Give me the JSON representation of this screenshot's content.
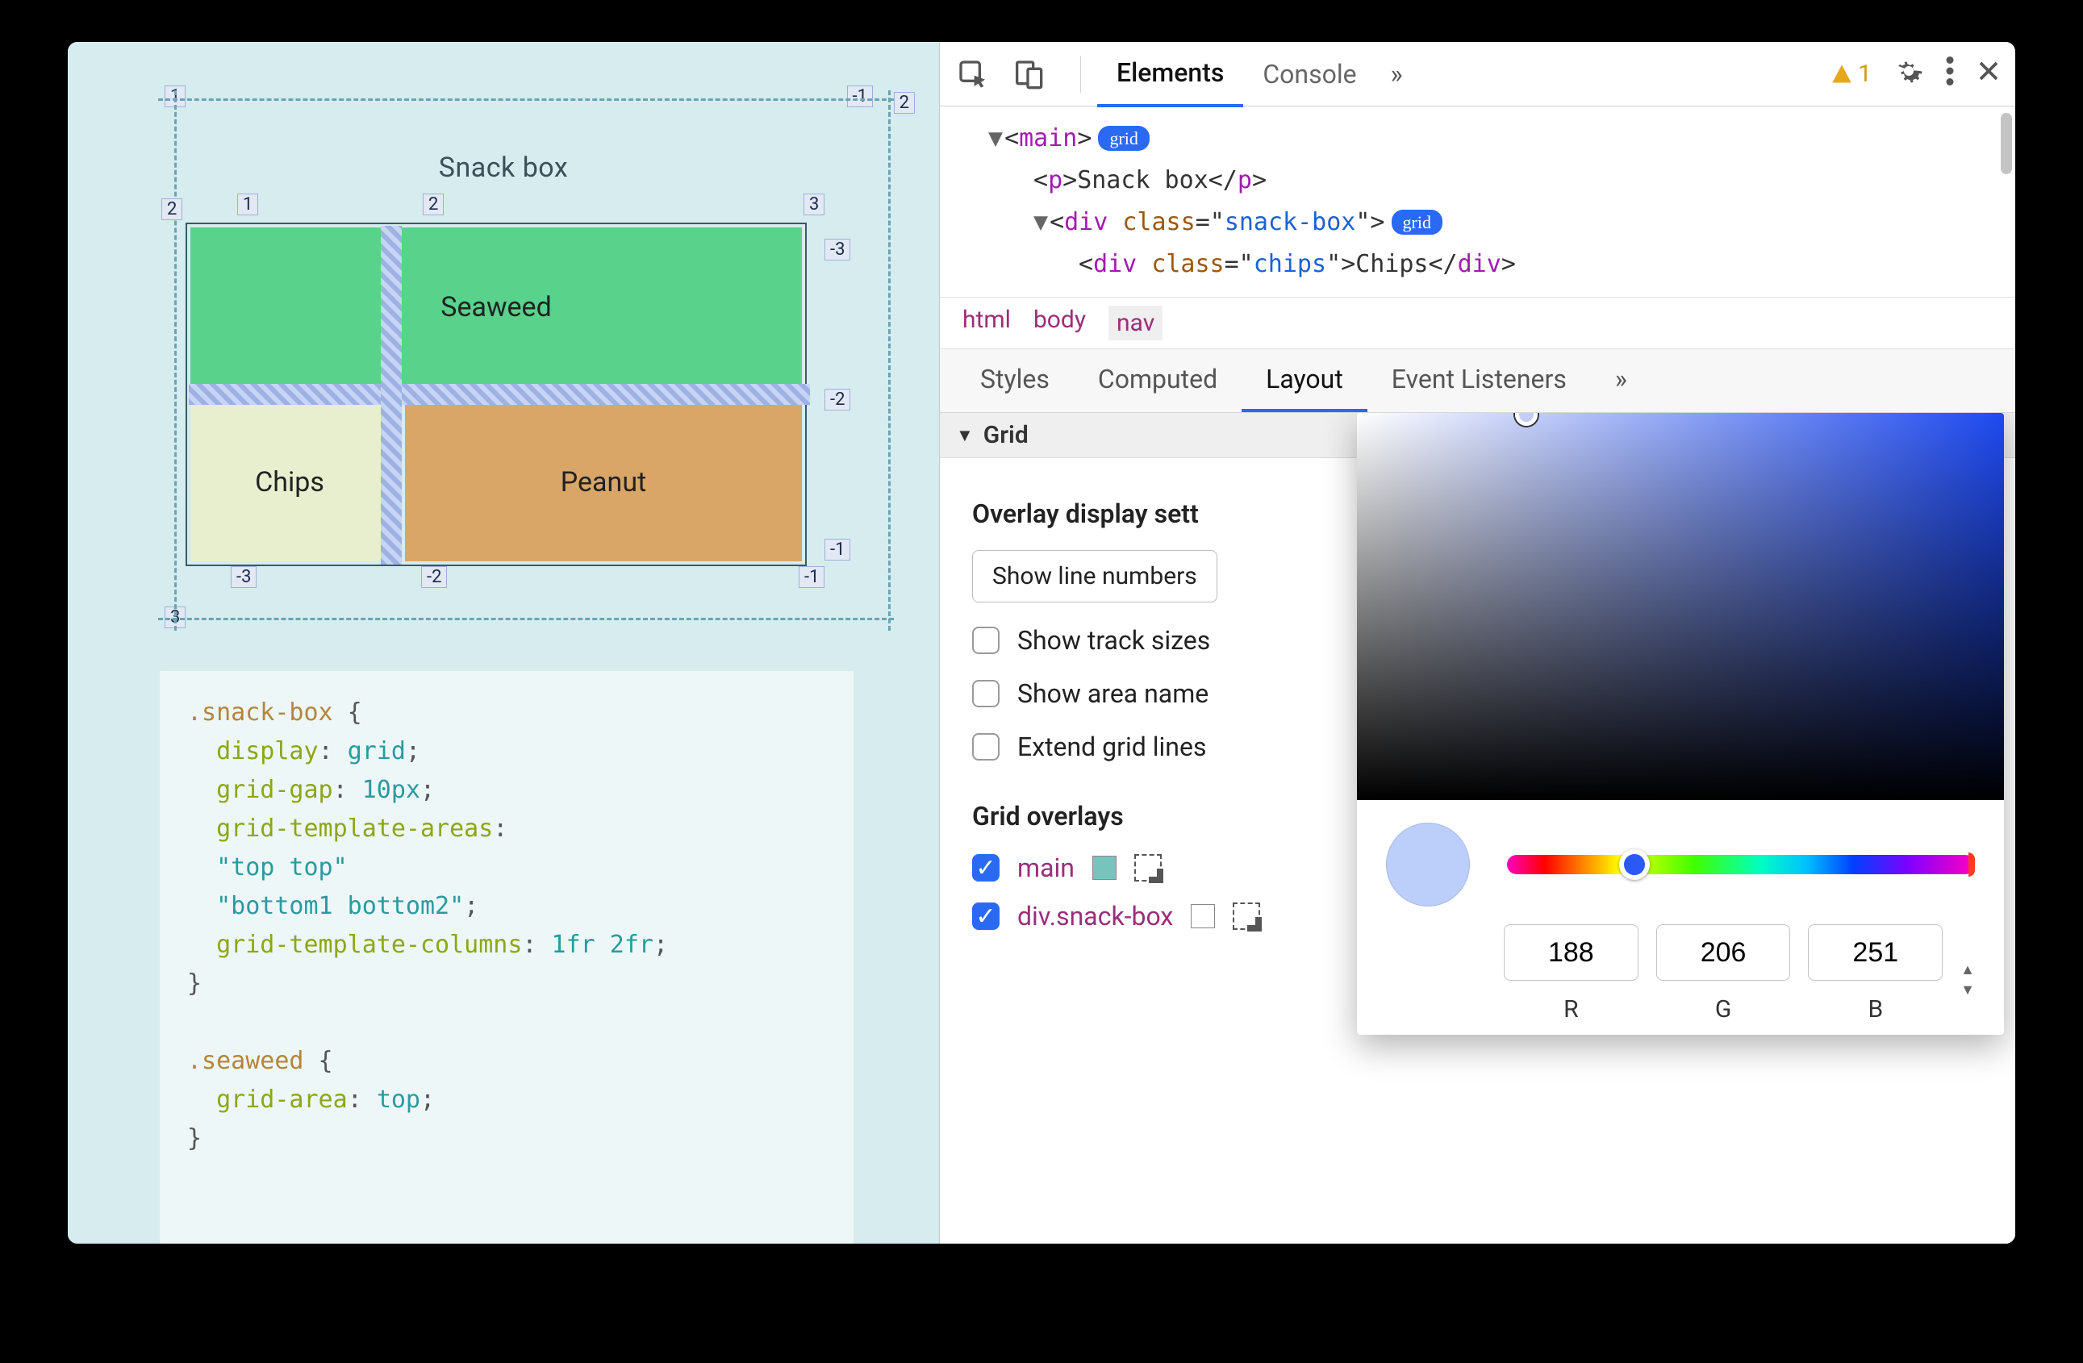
{
  "preview": {
    "title": "Snack box",
    "cells": {
      "seaweed": "Seaweed",
      "chips": "Chips",
      "peanut": "Peanut"
    },
    "code": ".snack-box {\n  display: grid;\n  grid-gap: 10px;\n  grid-template-areas:\n  \"top top\"\n  \"bottom1 bottom2\";\n  grid-template-columns: 1fr 2fr;\n}\n\n.seaweed {\n  grid-area: top;\n}"
  },
  "toolbar": {
    "tabs": {
      "elements": "Elements",
      "console": "Console"
    },
    "more": "»",
    "warn_count": "1"
  },
  "dom": {
    "l1": "main",
    "l1_badge": "grid",
    "l2_tag": "p",
    "l2_text": "Snack box",
    "l3_tag": "div",
    "l3_class": "snack-box",
    "l3_badge": "grid",
    "l4_tag": "div",
    "l4_class": "chips",
    "l4_text": "Chips"
  },
  "breadcrumbs": [
    "html",
    "body",
    "nav"
  ],
  "subtabs": {
    "styles": "Styles",
    "computed": "Computed",
    "layout": "Layout",
    "ev": "Event Listeners",
    "more": "»"
  },
  "layout": {
    "section": "Grid",
    "h_display": "Overlay display sett",
    "dropdown": "Show line numbers",
    "chk_track": "Show track sizes",
    "chk_area": "Show area name",
    "chk_ext": "Extend grid lines",
    "h_ov": "Grid overlays",
    "ov1": "main",
    "ov2": "div.snack-box"
  },
  "picker": {
    "r": "188",
    "g": "206",
    "b": "251",
    "lr": "R",
    "lg": "G",
    "lb": "B"
  }
}
